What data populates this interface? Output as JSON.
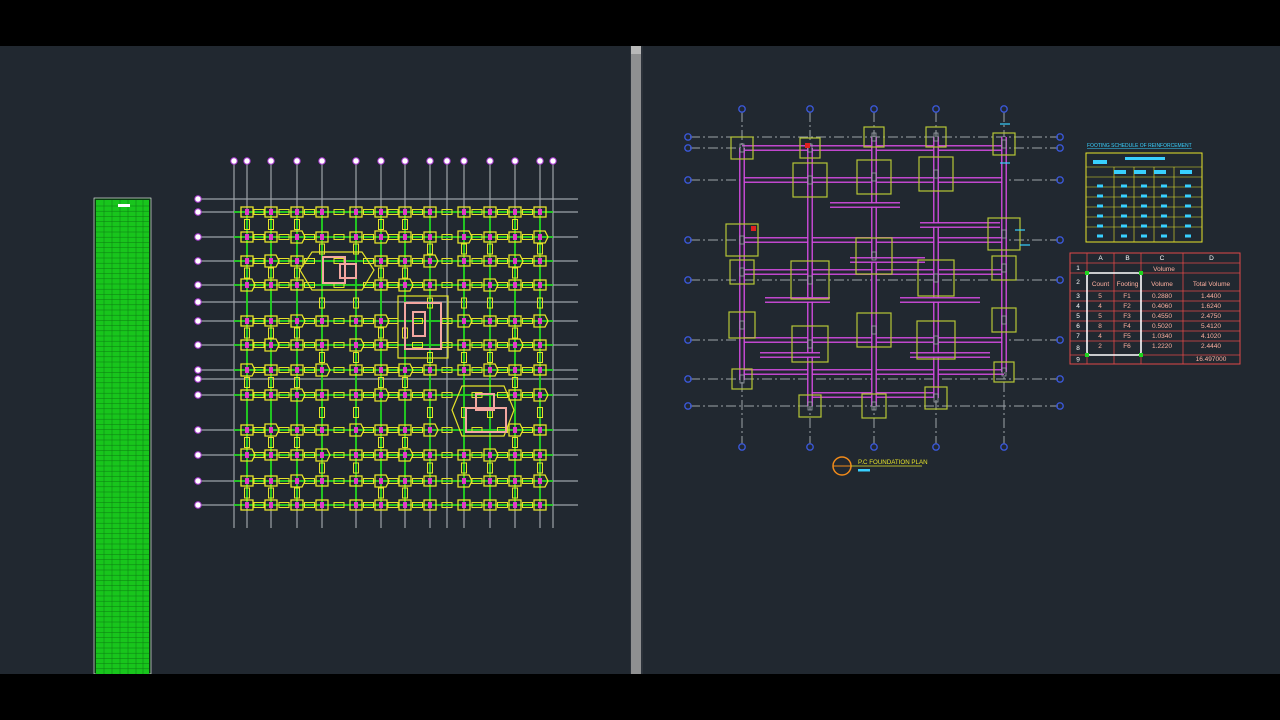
{
  "window": {
    "left_viewport": "multi-storey foundation drawing",
    "right_viewport": "footing plan with spreadsheet"
  },
  "colors": {
    "background": "#212830",
    "gridline": "#9da3a9",
    "beam": "#1fd41f",
    "footing": "#e6e32a",
    "column": "#e13cc8",
    "strip": "#d34ae0",
    "pile_cap": "#b6c636",
    "bubble": "#3a57d6",
    "sheet_border": "#e04848",
    "sheet_text": "#f0e030",
    "sheet_values": "#ffb0a0",
    "cyan": "#38d0ff"
  },
  "drawing_title": "P.C FOUNDATION PLAN",
  "schedule": {
    "title": "FOOTING SCHEDULE OF REINFORCEMENT"
  },
  "spreadsheet": {
    "column_headers": [
      "A",
      "B",
      "C",
      "D"
    ],
    "row_numbers": [
      "1",
      "2",
      "3",
      "4",
      "5",
      "6",
      "7",
      "8",
      "9"
    ],
    "title": "Volume",
    "headers": [
      "Count",
      "Footing",
      "Volume",
      "Total Volume"
    ],
    "rows": [
      {
        "count": "5",
        "footing": "F1",
        "volume": "0.2880",
        "total": "1.4400"
      },
      {
        "count": "4",
        "footing": "F2",
        "volume": "0.4060",
        "total": "1.6240"
      },
      {
        "count": "5",
        "footing": "F3",
        "volume": "0.4550",
        "total": "2.4750"
      },
      {
        "count": "8",
        "footing": "F4",
        "volume": "0.5020",
        "total": "5.4120"
      },
      {
        "count": "4",
        "footing": "F5",
        "volume": "1.0340",
        "total": "4.1020"
      },
      {
        "count": "2",
        "footing": "F6",
        "volume": "1.2220",
        "total": "2.4440"
      }
    ],
    "grand_total": "16.497000"
  },
  "left_vertical_grid": [
    234,
    247,
    271,
    297,
    322,
    356,
    381,
    405,
    430,
    447,
    464,
    490,
    515,
    540,
    553
  ],
  "left_horizontal_grid": [
    199,
    212,
    237,
    261,
    285,
    302,
    321,
    345,
    370,
    379,
    395,
    430,
    455,
    481,
    505
  ],
  "right_vertical_grid": [
    742,
    810,
    874,
    936,
    1004
  ],
  "right_horizontal_grid": [
    137,
    148,
    180,
    240,
    280,
    340,
    379,
    406
  ]
}
